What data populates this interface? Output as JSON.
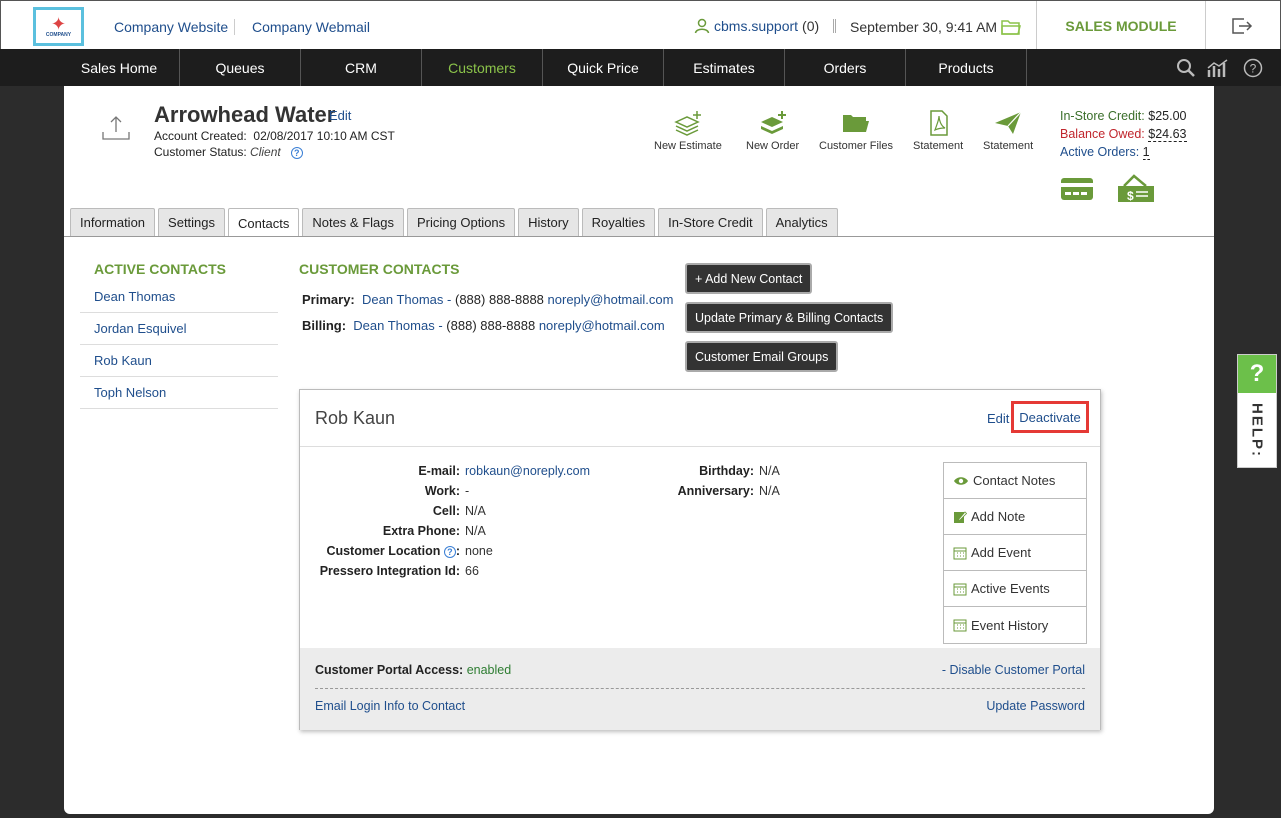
{
  "top": {
    "logo_text": "COMPANY",
    "company_website": "Company Website",
    "company_webmail": "Company Webmail",
    "user": "cbms.support",
    "user_count": "(0)",
    "datetime": "September 30, 9:41 AM",
    "module": "SALES MODULE"
  },
  "nav": [
    "Sales Home",
    "Queues",
    "CRM",
    "Customers",
    "Quick Price",
    "Estimates",
    "Orders",
    "Products"
  ],
  "customer": {
    "name": "Arrowhead Water",
    "edit": "Edit",
    "account_created_label": "Account Created:",
    "account_created": "02/08/2017 10:10 AM CST",
    "status_label": "Customer Status:",
    "status": "Client"
  },
  "actions": {
    "new_estimate": "New Estimate",
    "new_order": "New Order",
    "customer_files": "Customer Files",
    "statement1": "Statement",
    "statement2": "Statement"
  },
  "credit": {
    "instore_label": "In-Store Credit:",
    "instore_value": "$25.00",
    "balance_label": "Balance Owed:",
    "balance_value": "$24.63",
    "active_label": "Active Orders:",
    "active_value": "1"
  },
  "tabs": [
    "Information",
    "Settings",
    "Contacts",
    "Notes & Flags",
    "Pricing Options",
    "History",
    "Royalties",
    "In-Store Credit",
    "Analytics"
  ],
  "active_contacts": {
    "title": "ACTIVE CONTACTS",
    "items": [
      "Dean Thomas",
      "Jordan Esquivel",
      "Rob Kaun",
      "Toph Nelson"
    ]
  },
  "customer_contacts": {
    "title": "CUSTOMER CONTACTS",
    "primary_label": "Primary:",
    "primary_name": "Dean Thomas",
    "primary_phone": "(888) 888-8888",
    "primary_email": "noreply@hotmail.com",
    "billing_label": "Billing:",
    "billing_name": "Dean Thomas",
    "billing_phone": "(888) 888-8888",
    "billing_email": "noreply@hotmail.com",
    "dash": "-"
  },
  "buttons": {
    "add_contact": "+ Add New Contact",
    "update_primary": "Update Primary & Billing Contacts",
    "email_groups": "Customer Email Groups"
  },
  "contact": {
    "name": "Rob Kaun",
    "edit": "Edit",
    "deactivate": "Deactivate",
    "fields": [
      {
        "label": "E-mail:",
        "value": "robkaun@noreply.com"
      },
      {
        "label": "Work:",
        "value": "-"
      },
      {
        "label": "Cell:",
        "value": "N/A"
      },
      {
        "label": "Extra Phone:",
        "value": "N/A"
      },
      {
        "label": "Customer Location",
        "value": "none"
      },
      {
        "label": "Pressero Integration Id:",
        "value": "66"
      }
    ],
    "fields2": [
      {
        "label": "Birthday:",
        "value": "N/A"
      },
      {
        "label": "Anniversary:",
        "value": "N/A"
      }
    ],
    "side_menu": [
      "Contact Notes",
      "Add Note",
      "Add Event",
      "Active Events",
      "Event History"
    ],
    "portal_label": "Customer Portal Access:",
    "portal_value": "enabled",
    "disable_portal": "- Disable Customer Portal",
    "email_login": "Email Login Info to Contact",
    "update_password": "Update Password"
  },
  "help": {
    "q": "?",
    "label": "HELP:"
  },
  "colors": {
    "accent_green": "#6a9a3a",
    "link_blue": "#1f4e8c",
    "alert_red": "#e53935"
  }
}
